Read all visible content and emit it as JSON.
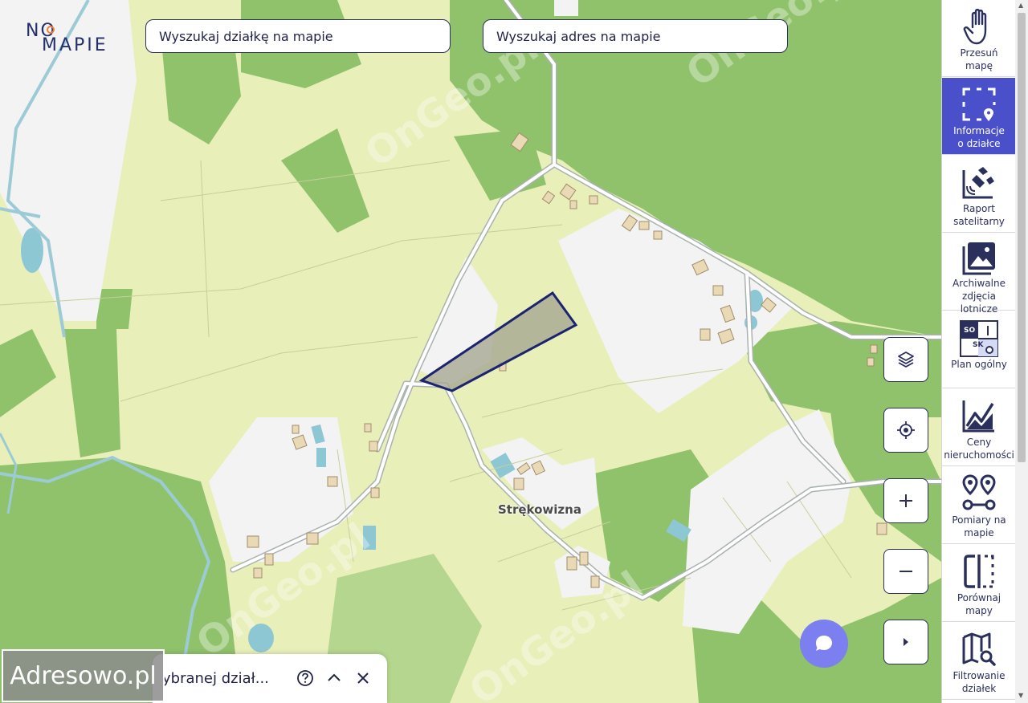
{
  "logo": {
    "line1": "NO",
    "line2": "MAPIE"
  },
  "search": {
    "plot_placeholder": "Wyszukaj działkę na mapie",
    "address_placeholder": "Wyszukaj adres na mapie"
  },
  "map": {
    "place_label": "Strękowizna",
    "watermark": "OnGeo.pl",
    "colors": {
      "forest": "#8fc26b",
      "meadow": "#e8efb9",
      "built": "#f3f3f3",
      "water": "#8ec7d4",
      "road": "#ffffff",
      "parcel": "#1c2370"
    }
  },
  "map_controls": {
    "layers_icon": "layers-icon",
    "locate_icon": "crosshair-icon",
    "zoom_in_icon": "plus-icon",
    "zoom_out_icon": "minus-icon",
    "expand_icon": "caret-right-icon"
  },
  "toolbar": {
    "items": [
      {
        "label": "Przesuń\nmapę",
        "icon": "hand-icon"
      },
      {
        "label": "Informacje\no działce",
        "icon": "select-pin-icon",
        "active": true
      },
      {
        "label": "Raport\nsatelitarny",
        "icon": "satellite-icon"
      },
      {
        "label": "Archiwalne\nzdjęcia\nlotnicze",
        "icon": "image-icon"
      },
      {
        "label": "Plan ogólny",
        "icon": "zoning-plan-icon"
      },
      {
        "label": "Ceny\nnieruchomości",
        "icon": "chart-icon"
      },
      {
        "label": "Pomiary na\nmapie",
        "icon": "measure-pins-icon"
      },
      {
        "label": "Porównaj\nmapy",
        "icon": "compare-icon"
      },
      {
        "label": "Filtrowanie\ndziałek",
        "icon": "map-search-icon"
      }
    ]
  },
  "bottom_panel": {
    "text": "ybranej dział..."
  },
  "watermark_badge": "Adresowo.pl"
}
